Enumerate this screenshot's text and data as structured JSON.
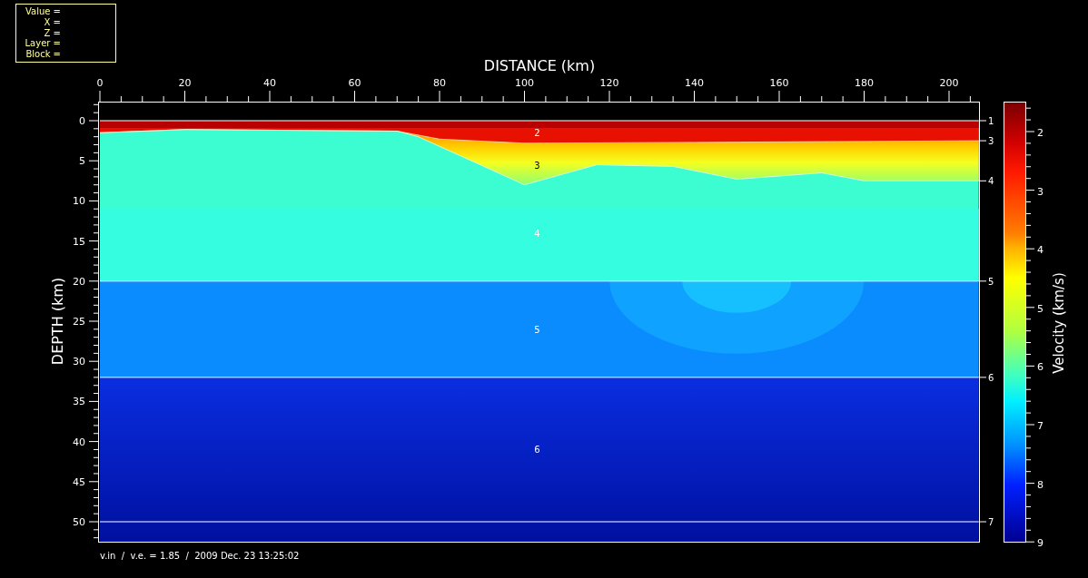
{
  "info_box": {
    "lines": [
      "Value =",
      "X =",
      "Z =",
      "Layer =",
      "Block ="
    ]
  },
  "x_axis": {
    "title": "DISTANCE (km)",
    "ticks": [
      "0",
      "20",
      "40",
      "60",
      "80",
      "100",
      "120",
      "140",
      "160",
      "180",
      "200"
    ]
  },
  "y_axis": {
    "title": "DEPTH (km)",
    "ticks": [
      "0",
      "5",
      "10",
      "15",
      "20",
      "25",
      "30",
      "35",
      "40",
      "45",
      "50"
    ]
  },
  "layer_labels": [
    "2",
    "3",
    "4",
    "5",
    "6"
  ],
  "boundary_labels": [
    "1",
    "3",
    "4",
    "5",
    "6",
    "7"
  ],
  "colorbar": {
    "title": "Velocity (km/s)",
    "ticks": [
      "2",
      "3",
      "4",
      "5",
      "6",
      "7",
      "8",
      "9"
    ]
  },
  "footer": "v.in  /  v.e. = 1.85  /  2009 Dec. 23 13:25:02"
}
